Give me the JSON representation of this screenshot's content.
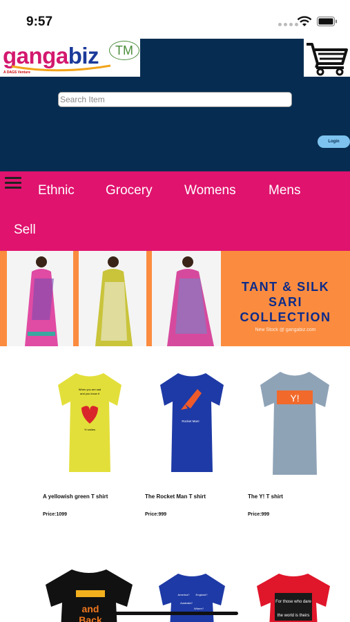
{
  "status_bar": {
    "time": "9:57"
  },
  "header": {
    "logo_text": "gangabiz",
    "logo_tm": "TM",
    "logo_tagline": "A DAGS Venture",
    "search_placeholder": "Search Item",
    "login_label": "Login"
  },
  "nav": {
    "items": [
      "Ethnic",
      "Grocery",
      "Womens",
      "Mens",
      "Sell"
    ]
  },
  "banner": {
    "line1": "TANT & SILK",
    "line2": "SARI",
    "line3": "COLLECTION",
    "sub": "New Stock @ gangabiz.com"
  },
  "products": [
    {
      "name": "A yellowish green T shirt",
      "price": "Price:1099",
      "shirt_color": "#e3df3a",
      "print_text": "When you are sad and you know it / Yt smiles"
    },
    {
      "name": "The Rocket Man T shirt",
      "price": "Price:999",
      "shirt_color": "#1e3aa6",
      "print_text": "Rocket Man!"
    },
    {
      "name": "The Y! T shirt",
      "price": "Price:999",
      "shirt_color": "#8fa3b7",
      "print_text": "Y!"
    }
  ],
  "products_row2": [
    {
      "shirt_color": "#111111",
      "print_text": "and Back"
    },
    {
      "shirt_color": "#1e3aa6",
      "print_text": "America? England? Australia? Where? Bangladesh?"
    },
    {
      "shirt_color": "#e0162b",
      "print_text": "For those who dare the world is theirs"
    }
  ],
  "colors": {
    "header_bg": "#062d51",
    "nav_bg": "#e0136e",
    "banner_orange": "#fb8c3f",
    "login_bg": "#7ec3f0"
  }
}
